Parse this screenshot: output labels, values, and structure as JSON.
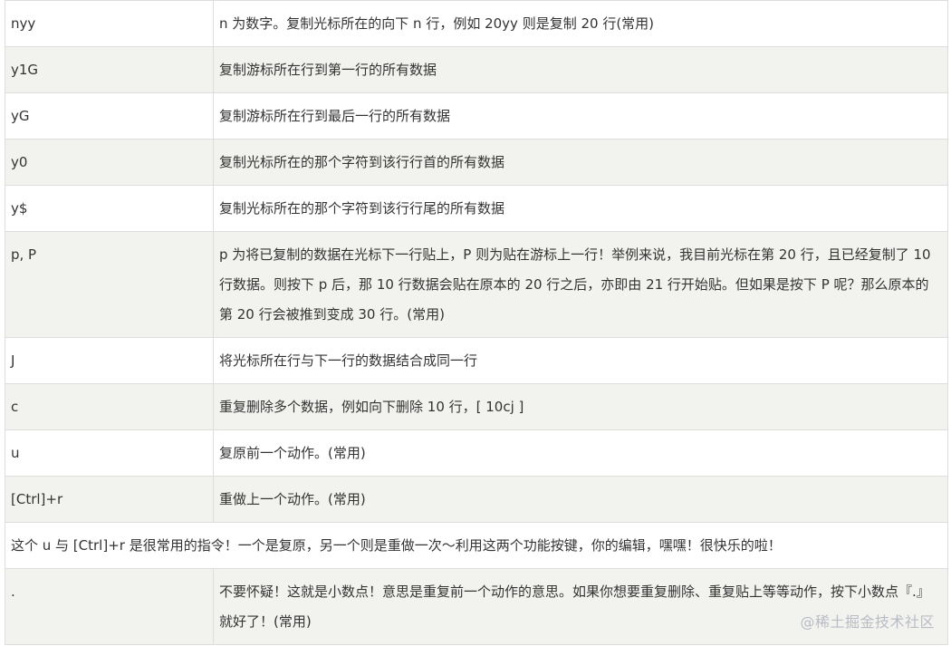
{
  "rows": [
    {
      "key": "nyy",
      "desc": "n 为数字。复制光标所在的向下 n 行，例如 20yy 则是复制 20 行(常用)"
    },
    {
      "key": "y1G",
      "desc": "复制游标所在行到第一行的所有数据"
    },
    {
      "key": "yG",
      "desc": "复制游标所在行到最后一行的所有数据"
    },
    {
      "key": "y0",
      "desc": "复制光标所在的那个字符到该行行首的所有数据"
    },
    {
      "key": "y$",
      "desc": "复制光标所在的那个字符到该行行尾的所有数据"
    },
    {
      "key": "p, P",
      "desc": "p 为将已复制的数据在光标下一行贴上，P 则为贴在游标上一行！举例来说，我目前光标在第 20 行，且已经复制了 10 行数据。则按下 p 后，那 10 行数据会贴在原本的 20 行之后，亦即由 21 行开始贴。但如果是按下 P 呢？那么原本的第 20 行会被推到变成 30 行。(常用)"
    },
    {
      "key": "J",
      "desc": "将光标所在行与下一行的数据结合成同一行"
    },
    {
      "key": "c",
      "desc": "重复删除多个数据，例如向下删除 10 行，[ 10cj ]"
    },
    {
      "key": "u",
      "desc": "复原前一个动作。(常用)"
    },
    {
      "key": "[Ctrl]+r",
      "desc": "重做上一个动作。(常用)"
    }
  ],
  "note": "这个 u 与 [Ctrl]+r 是很常用的指令！一个是复原，另一个则是重做一次～利用这两个功能按键，你的编辑，嘿嘿！很快乐的啦！",
  "last_row": {
    "key": ".",
    "desc": "不要怀疑！这就是小数点！意思是重复前一个动作的意思。如果你想要重复删除、重复贴上等等动作，按下小数点『.』就好了！(常用)"
  },
  "watermark": "@稀土掘金技术社区"
}
